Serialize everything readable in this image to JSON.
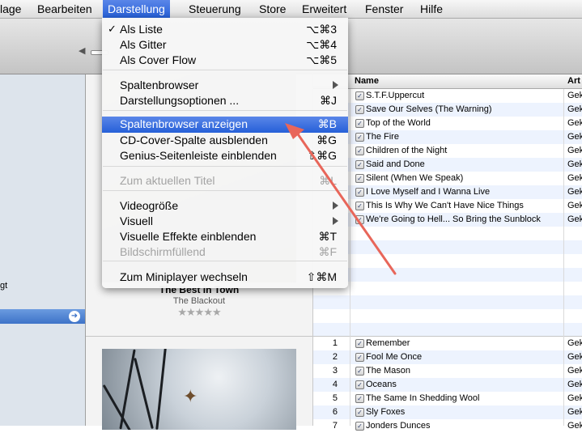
{
  "menubar": {
    "items": [
      {
        "label": "lage"
      },
      {
        "label": "Bearbeiten"
      },
      {
        "label": "Darstellung"
      },
      {
        "label": "Steuerung"
      },
      {
        "label": "Store"
      },
      {
        "label": "Erweitert"
      },
      {
        "label": "Fenster"
      },
      {
        "label": "Hilfe"
      }
    ],
    "active": "Darstellung",
    "accent_color": "#2f6ae0"
  },
  "sidebar": {
    "fragment_text": "gt"
  },
  "album1": {
    "title": "The Best In Town",
    "artist": "The Blackout",
    "rating_stars": "★★★★★",
    "rating_value": 0
  },
  "view_menu": {
    "items": [
      {
        "label": "Als Liste",
        "shortcut": "⌥⌘3",
        "checked": true
      },
      {
        "label": "Als Gitter",
        "shortcut": "⌥⌘4"
      },
      {
        "label": "Als Cover Flow",
        "shortcut": "⌥⌘5"
      },
      {
        "label": "Spaltenbrowser",
        "submenu": true
      },
      {
        "label": "Darstellungsoptionen ...",
        "shortcut": "⌘J"
      },
      {
        "label": "Spaltenbrowser anzeigen",
        "shortcut": "⌘B",
        "highlighted": true
      },
      {
        "label": "CD-Cover-Spalte ausblenden",
        "shortcut": "⌘G"
      },
      {
        "label": "Genius-Seitenleiste einblenden",
        "shortcut": "⇧⌘G"
      },
      {
        "label": "Zum aktuellen Titel",
        "shortcut": "⌘L",
        "disabled": true
      },
      {
        "label": "Videogröße",
        "submenu": true
      },
      {
        "label": "Visuell",
        "submenu": true
      },
      {
        "label": "Visuelle Effekte einblenden",
        "shortcut": "⌘T"
      },
      {
        "label": "Bildschirmfüllend",
        "shortcut": "⌘F",
        "disabled": true
      },
      {
        "label": "Zum Miniplayer wechseln",
        "shortcut": "⇧⌘M"
      }
    ]
  },
  "tracklist": {
    "columns": {
      "name": "Name",
      "artist": "Art"
    },
    "album1_tracks": [
      {
        "name": "S.T.F.Uppercut",
        "artist": "Gek"
      },
      {
        "name": "Save Our Selves (The Warning)",
        "artist": "Gek"
      },
      {
        "name": "Top of the World",
        "artist": "Gek"
      },
      {
        "name": "The Fire",
        "artist": "Gek"
      },
      {
        "name": "Children of the Night",
        "artist": "Gek"
      },
      {
        "name": "Said and Done",
        "artist": "Gek"
      },
      {
        "name": "Silent (When We Speak)",
        "artist": "Gek"
      },
      {
        "name": "I Love Myself and I Wanna Live",
        "artist": "Gek"
      },
      {
        "name": "This Is Why We Can't Have Nice Things",
        "artist": "Gek"
      },
      {
        "name": "We're Going to Hell... So Bring the Sunblock",
        "artist": "Gek"
      }
    ],
    "album2_tracks": [
      {
        "num": "1",
        "name": "Remember",
        "artist": "Gek"
      },
      {
        "num": "2",
        "name": "Fool Me Once",
        "artist": "Gek"
      },
      {
        "num": "3",
        "name": "The Mason",
        "artist": "Gek"
      },
      {
        "num": "4",
        "name": "Oceans",
        "artist": "Gek"
      },
      {
        "num": "5",
        "name": "The Same In Shedding Wool",
        "artist": "Gek"
      },
      {
        "num": "6",
        "name": "Sly Foxes",
        "artist": "Gek"
      },
      {
        "num": "7",
        "name": "Jonders Dunces",
        "artist": "Gek"
      }
    ]
  },
  "icons": {
    "speaker": "speaker-icon",
    "bird": "bird-icon",
    "checkbox": "checkbox-checked-icon",
    "submenu": "chevron-right-icon"
  },
  "annotation_arrow_color": "#e8665a"
}
